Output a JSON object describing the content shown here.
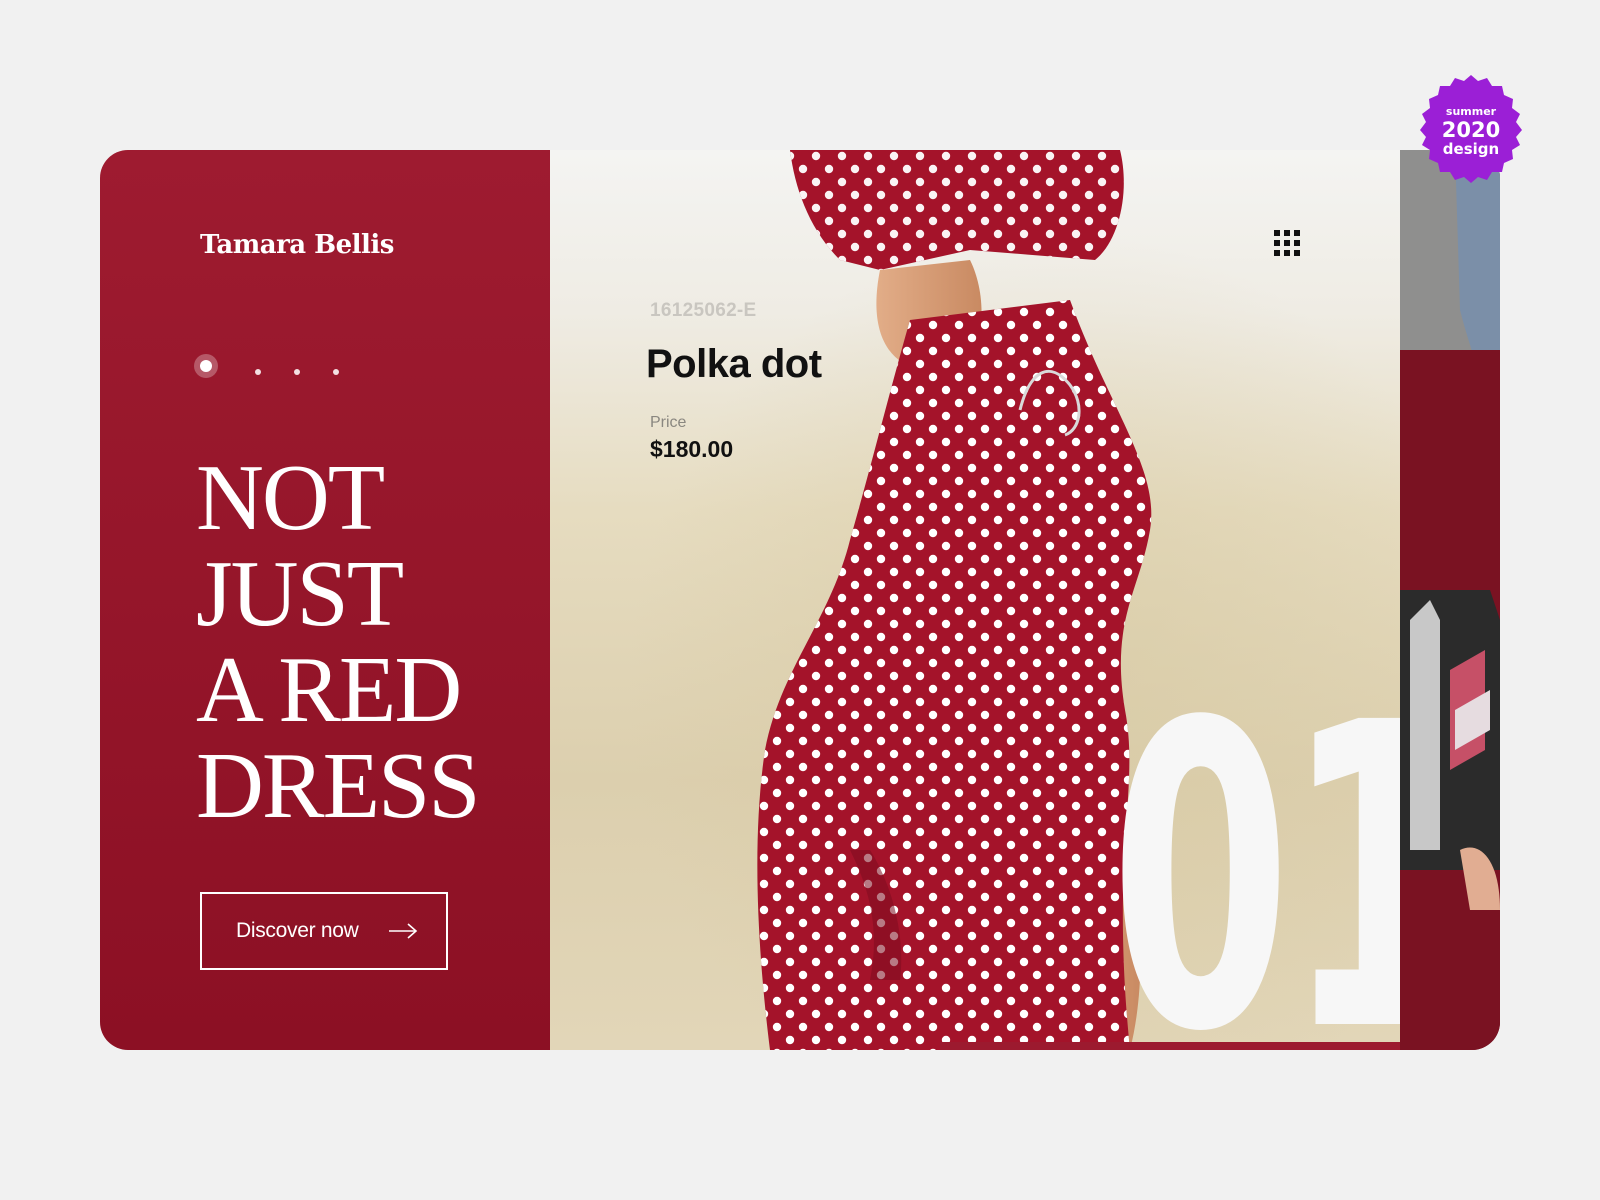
{
  "brand": {
    "name": "Tamara Bellis"
  },
  "slider": {
    "count": 4,
    "active_index": 0
  },
  "hero": {
    "lines": [
      "NOT",
      "JUST",
      "A RED",
      "DRESS"
    ],
    "cta_label": "Discover now"
  },
  "product": {
    "sku": "16125062-E",
    "name": "Polka dot",
    "price_label": "Price",
    "price": "$180.00",
    "slide_number": "01"
  },
  "badge": {
    "top": "summer",
    "middle": "2020",
    "bottom": "design"
  },
  "icons": {
    "menu": "grid-menu-icon",
    "cta": "arrow-right-icon"
  },
  "colors": {
    "accent": "#9e1b30",
    "badge": "#9b1fd6",
    "background": "#f1f1f1"
  }
}
